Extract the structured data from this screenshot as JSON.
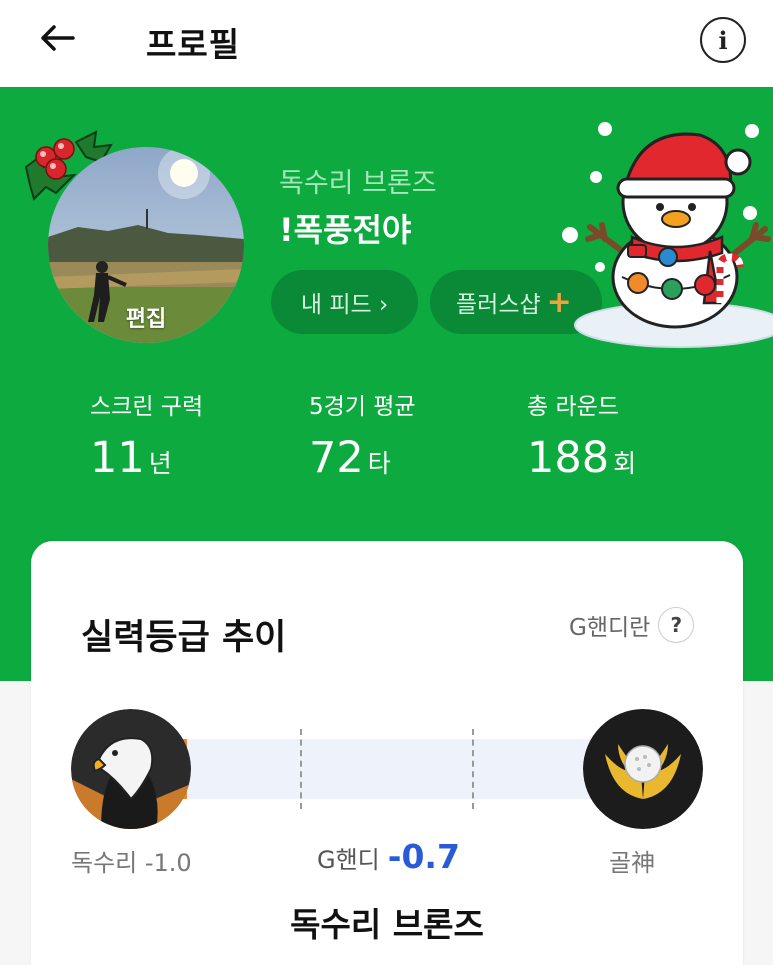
{
  "header": {
    "title": "프로필",
    "info_icon": "i"
  },
  "profile": {
    "edit_label": "편집",
    "grade_name": "독수리 브론즈",
    "nickname": "!폭풍전야",
    "feed_button": "내 피드 ›",
    "shop_button": "플러스샵",
    "shop_plus_icon": "+"
  },
  "stats": [
    {
      "label": "스크린 구력",
      "value": "11",
      "unit": "년"
    },
    {
      "label": "5경기 평균",
      "value": "72",
      "unit": "타"
    },
    {
      "label": "총 라운드",
      "value": "188",
      "unit": "회"
    }
  ],
  "card": {
    "title": "실력등급 추이",
    "ghandi_link": "G핸디란",
    "help_icon": "?",
    "current_grade_label": "독수리 -1.0",
    "ghandi_label": "G핸디",
    "ghandi_value": "-0.7",
    "next_grade_label": "골神",
    "progress_fraction": 0.01,
    "current_grade_name": "독수리 브론즈"
  },
  "colors": {
    "brand_green": "#0caa3f",
    "pill_green": "#0a8a37",
    "accent_blue": "#2a5bd7",
    "progress_orange": "#e88a2e"
  }
}
